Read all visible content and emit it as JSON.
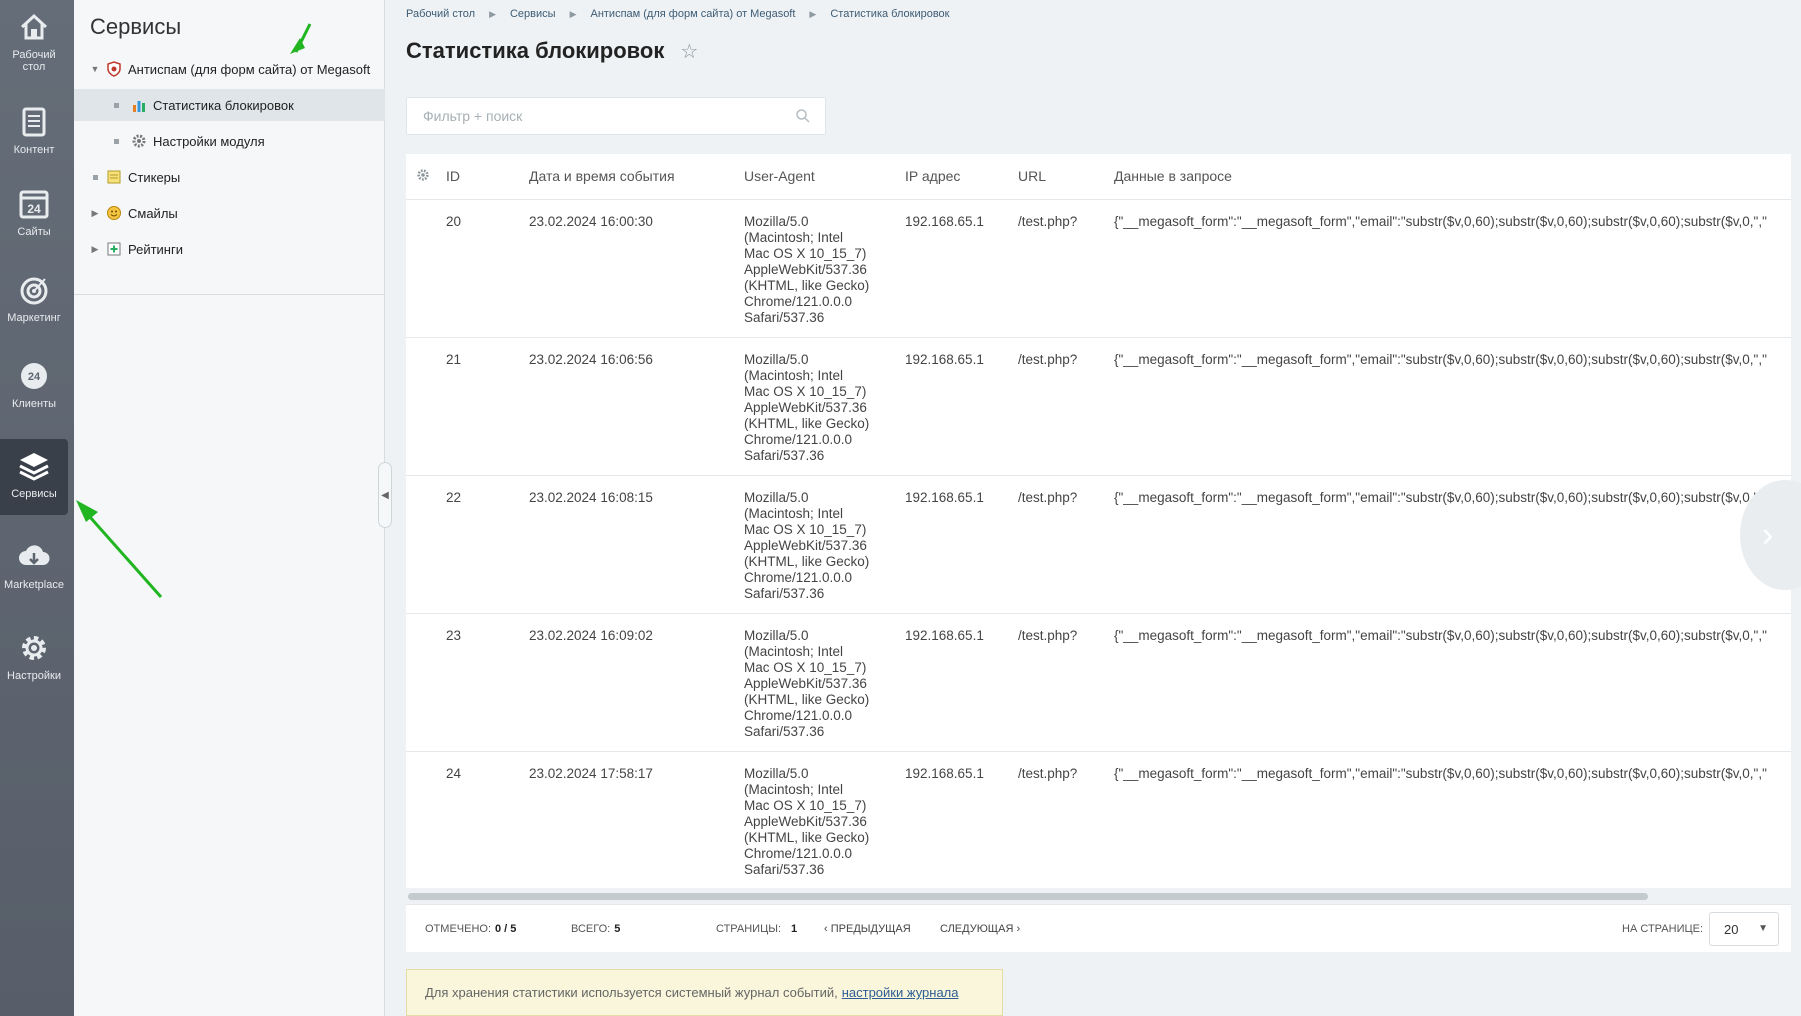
{
  "iconbar": {
    "items": [
      {
        "label": "Рабочий стол",
        "icon": "home-icon"
      },
      {
        "label": "Контент",
        "icon": "document-icon"
      },
      {
        "label": "Сайты",
        "icon": "calendar-icon"
      },
      {
        "label": "Маркетинг",
        "icon": "target-icon"
      },
      {
        "label": "Клиенты",
        "icon": "clients-icon"
      },
      {
        "label": "Сервисы",
        "icon": "layers-icon"
      },
      {
        "label": "Marketplace",
        "icon": "cloud-download-icon"
      },
      {
        "label": "Настройки",
        "icon": "gear-icon"
      }
    ]
  },
  "tree": {
    "title": "Сервисы",
    "items": [
      {
        "label": "Антиспам (для форм сайта) от Megasoft"
      },
      {
        "label": "Статистика блокировок"
      },
      {
        "label": "Настройки модуля"
      },
      {
        "label": "Стикеры"
      },
      {
        "label": "Смайлы"
      },
      {
        "label": "Рейтинги"
      }
    ]
  },
  "breadcrumb": [
    "Рабочий стол",
    "Сервисы",
    "Антиспам (для форм сайта) от Megasoft",
    "Статистика блокировок"
  ],
  "page": {
    "title": "Статистика блокировок"
  },
  "filter": {
    "placeholder": "Фильтр + поиск"
  },
  "table": {
    "columns": [
      "ID",
      "Дата и время события",
      "User-Agent",
      "IP адрес",
      "URL",
      "Данные в запросе"
    ],
    "rows": [
      {
        "id": "20",
        "date": "23.02.2024 16:00:30",
        "ua": "Mozilla/5.0\n(Macintosh; Intel\nMac OS X 10_15_7)\nAppleWebKit/537.36\n(KHTML, like Gecko)\nChrome/121.0.0.0\nSafari/537.36",
        "ip": "192.168.65.1",
        "url": "/test.php?",
        "data": "{\"__megasoft_form\":\"__megasoft_form\",\"email\":\"substr($v,0,60);substr($v,0,60);substr($v,0,60);substr($v,0,\",\""
      },
      {
        "id": "21",
        "date": "23.02.2024 16:06:56",
        "ua": "Mozilla/5.0\n(Macintosh; Intel\nMac OS X 10_15_7)\nAppleWebKit/537.36\n(KHTML, like Gecko)\nChrome/121.0.0.0\nSafari/537.36",
        "ip": "192.168.65.1",
        "url": "/test.php?",
        "data": "{\"__megasoft_form\":\"__megasoft_form\",\"email\":\"substr($v,0,60);substr($v,0,60);substr($v,0,60);substr($v,0,\",\""
      },
      {
        "id": "22",
        "date": "23.02.2024 16:08:15",
        "ua": "Mozilla/5.0\n(Macintosh; Intel\nMac OS X 10_15_7)\nAppleWebKit/537.36\n(KHTML, like Gecko)\nChrome/121.0.0.0\nSafari/537.36",
        "ip": "192.168.65.1",
        "url": "/test.php?",
        "data": "{\"__megasoft_form\":\"__megasoft_form\",\"email\":\"substr($v,0,60);substr($v,0,60);substr($v,0,60);substr($v,0,\",\""
      },
      {
        "id": "23",
        "date": "23.02.2024 16:09:02",
        "ua": "Mozilla/5.0\n(Macintosh; Intel\nMac OS X 10_15_7)\nAppleWebKit/537.36\n(KHTML, like Gecko)\nChrome/121.0.0.0\nSafari/537.36",
        "ip": "192.168.65.1",
        "url": "/test.php?",
        "data": "{\"__megasoft_form\":\"__megasoft_form\",\"email\":\"substr($v,0,60);substr($v,0,60);substr($v,0,60);substr($v,0,\",\""
      },
      {
        "id": "24",
        "date": "23.02.2024 17:58:17",
        "ua": "Mozilla/5.0\n(Macintosh; Intel\nMac OS X 10_15_7)\nAppleWebKit/537.36\n(KHTML, like Gecko)\nChrome/121.0.0.0\nSafari/537.36",
        "ip": "192.168.65.1",
        "url": "/test.php?",
        "data": "{\"__megasoft_form\":\"__megasoft_form\",\"email\":\"substr($v,0,60);substr($v,0,60);substr($v,0,60);substr($v,0,\",\""
      }
    ]
  },
  "footer": {
    "selected_label": "Отмечено:",
    "selected_value": "0 / 5",
    "total_label": "Всего:",
    "total_value": "5",
    "pages_label": "Страницы:",
    "pages_value": "1",
    "prev_label": "Предыдущая",
    "next_label": "Следующая",
    "perpage_label": "На странице:",
    "perpage_value": "20"
  },
  "notice": {
    "text": "Для хранения статистики используется системный журнал событий,",
    "link": "настройки журнала"
  },
  "colors": {
    "annotation_arrow": "#21b521",
    "iconbar_bg": "#5c6470",
    "notice_bg": "#f9f6db"
  }
}
